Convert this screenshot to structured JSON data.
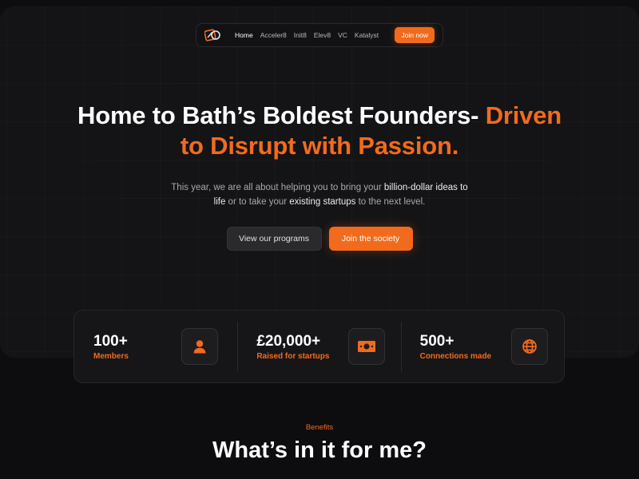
{
  "nav": {
    "logo_icon": "society-logo-icon",
    "links": [
      "Home",
      "Acceler8",
      "Init8",
      "Elev8",
      "VC",
      "Katalyst"
    ],
    "active": "Home",
    "cta": "Join now"
  },
  "hero": {
    "title_part1": "Home to Bath’s Boldest Founders- ",
    "title_part2": "Driven",
    "title_part3": "to Disrupt with Passion.",
    "sub_1": "This year, we are all about helping you to bring your ",
    "sub_hl1": "billion-dollar ideas to",
    "sub_hl2": "life",
    "sub_2": " or to take your ",
    "sub_hl3": "existing startups",
    "sub_3": " to the next level.",
    "btn_secondary": "View our programs",
    "btn_primary": "Join the society"
  },
  "stats": [
    {
      "value": "100+",
      "label": "Members",
      "icon": "user-icon"
    },
    {
      "value": "£20,000+",
      "label": "Raised for startups",
      "icon": "banknote-icon"
    },
    {
      "value": "500+",
      "label": "Connections made",
      "icon": "globe-icon"
    }
  ],
  "benefits": {
    "eyebrow": "Benefits",
    "title": "What’s in it for me?"
  },
  "colors": {
    "accent": "#f26b1d",
    "background": "#0d0d0f",
    "card": "#161618"
  }
}
